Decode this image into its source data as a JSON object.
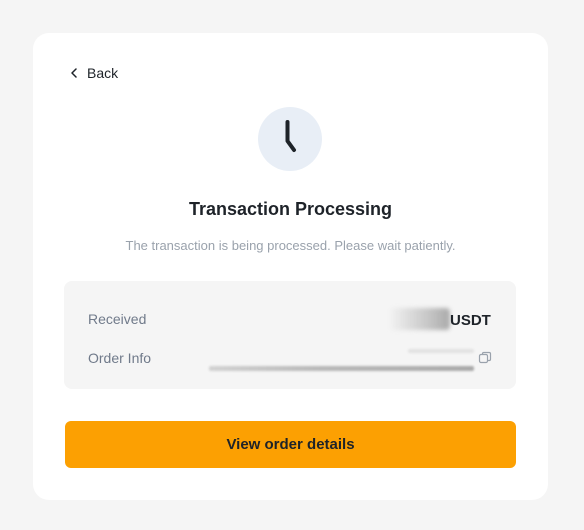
{
  "back": {
    "label": "Back"
  },
  "status": {
    "title": "Transaction Processing",
    "subtitle": "The transaction is being processed. Please wait patiently.",
    "icon": "clock-icon"
  },
  "details": {
    "received_label": "Received",
    "received_currency": "USDT",
    "order_info_label": "Order Info"
  },
  "actions": {
    "view_details_label": "View order details"
  },
  "colors": {
    "page_bg": "#f5f5f5",
    "card_bg": "#ffffff",
    "accent": "#fca002",
    "text_primary": "#1e2329",
    "text_secondary": "#707a8a",
    "text_muted": "#9aa2ac",
    "icon_bg": "#e8eef6"
  }
}
